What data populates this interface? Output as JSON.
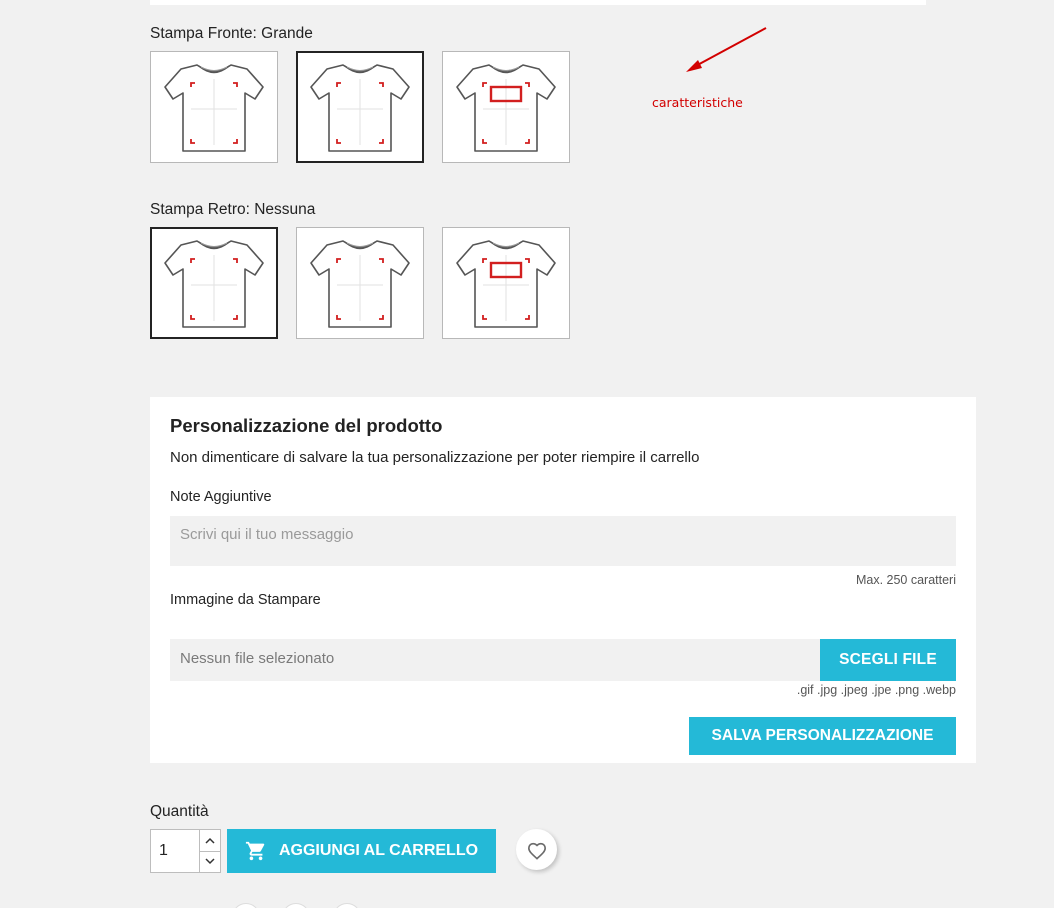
{
  "front": {
    "label": "Stampa Fronte: Grande",
    "options": [
      {
        "name": "front-option-1",
        "print_box": false
      },
      {
        "name": "front-option-2",
        "print_box": false,
        "selected": true
      },
      {
        "name": "front-option-3",
        "print_box": true
      }
    ]
  },
  "back": {
    "label": "Stampa Retro: Nessuna",
    "options": [
      {
        "name": "back-option-1",
        "print_box": false,
        "selected": true
      },
      {
        "name": "back-option-2",
        "print_box": false
      },
      {
        "name": "back-option-3",
        "print_box": true
      }
    ]
  },
  "annotation": {
    "text": "caratteristiche",
    "color": "#d20000"
  },
  "customization": {
    "title": "Personalizzazione del prodotto",
    "subtitle": "Non dimenticare di salvare la tua personalizzazione per poter riempire il carrello",
    "notes_label": "Note Aggiuntive",
    "notes_placeholder": "Scrivi qui il tuo messaggio",
    "max_chars": "Max. 250 caratteri",
    "image_label": "Immagine da Stampare",
    "file_status": "Nessun file selezionato",
    "file_button": "SCEGLI FILE",
    "formats": ".gif .jpg .jpeg .jpe .png .webp",
    "save_button": "SALVA PERSONALIZZAZIONE"
  },
  "cart": {
    "quantity_label": "Quantità",
    "quantity_value": "1",
    "add_button": "AGGIUNGI AL CARRELLO",
    "add_icon": "cart-icon",
    "wishlist_icon": "heart-icon"
  },
  "colors": {
    "accent": "#24b9d7",
    "background": "#f1f1f1",
    "print_mark": "#d21f1f"
  }
}
